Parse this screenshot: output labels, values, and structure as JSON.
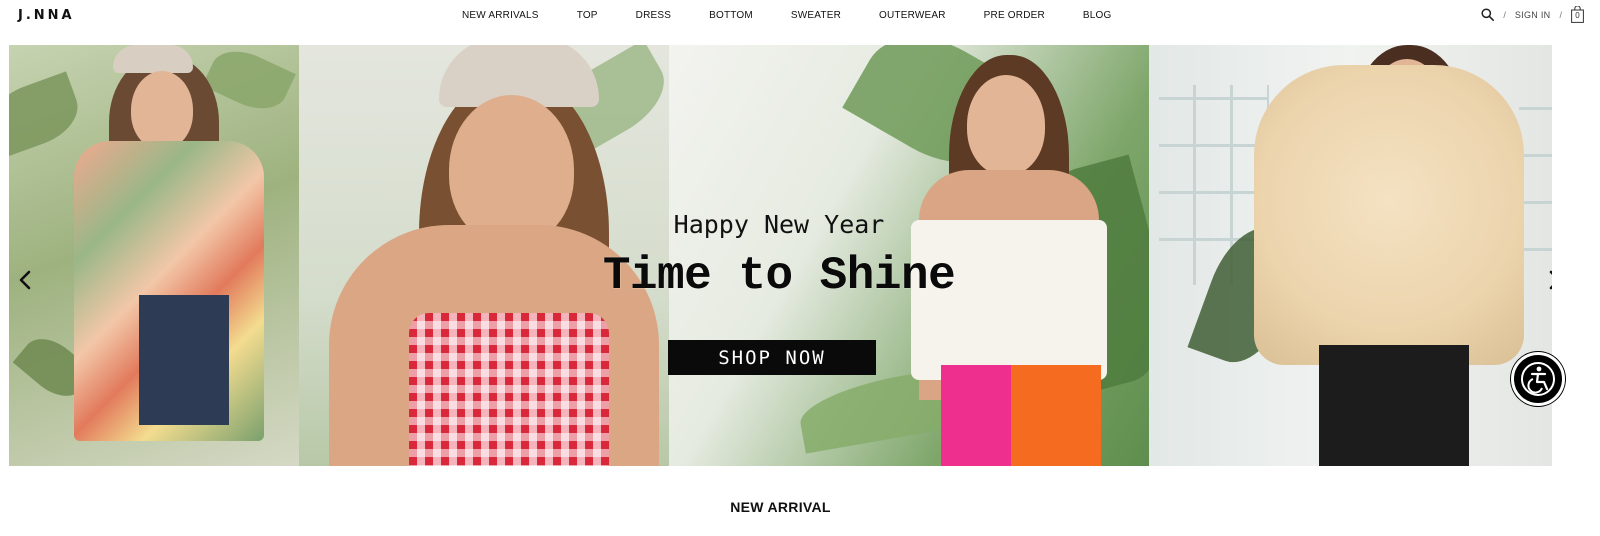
{
  "header": {
    "logo": "J.NNA",
    "nav": [
      {
        "label": "NEW ARRIVALS"
      },
      {
        "label": "TOP"
      },
      {
        "label": "DRESS"
      },
      {
        "label": "BOTTOM"
      },
      {
        "label": "SWEATER"
      },
      {
        "label": "OUTERWEAR"
      },
      {
        "label": "PRE ORDER"
      },
      {
        "label": "BLOG"
      }
    ],
    "utils": {
      "search_icon": "search-icon",
      "separator": "/",
      "sign_in": "SIGN IN",
      "cart_icon": "shopping-bag-icon",
      "cart_count": "0"
    }
  },
  "hero": {
    "subtitle": "Happy New Year",
    "title": "Time to Shine",
    "cta": "SHOP NOW",
    "prev_icon": "chevron-left-icon",
    "next_icon": "chevron-right-icon"
  },
  "accessibility": {
    "icon": "accessibility-icon"
  },
  "section": {
    "title": "NEW ARRIVAL"
  },
  "colors": {
    "text": "#111111",
    "button_bg": "#0a0a0a",
    "button_text": "#ffffff"
  }
}
